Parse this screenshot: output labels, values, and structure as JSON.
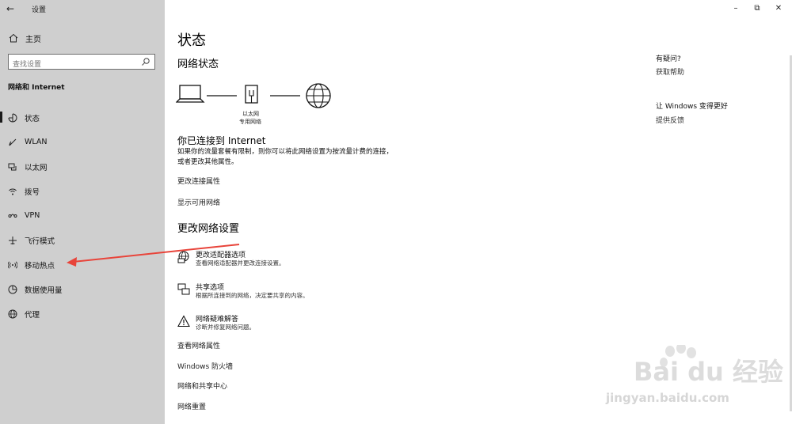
{
  "window": {
    "title": "设置"
  },
  "sidebar": {
    "home_label": "主页",
    "search_placeholder": "查找设置",
    "section_title": "网络和 Internet",
    "items": [
      {
        "label": "状态",
        "icon": "status-icon",
        "selected": true
      },
      {
        "label": "WLAN",
        "icon": "wifi-icon"
      },
      {
        "label": "以太网",
        "icon": "ethernet-icon"
      },
      {
        "label": "拨号",
        "icon": "dialup-icon"
      },
      {
        "label": "VPN",
        "icon": "vpn-icon"
      },
      {
        "label": "飞行模式",
        "icon": "airplane-icon"
      },
      {
        "label": "移动热点",
        "icon": "hotspot-icon"
      },
      {
        "label": "数据使用量",
        "icon": "data-usage-icon"
      },
      {
        "label": "代理",
        "icon": "globe-icon"
      }
    ]
  },
  "main": {
    "title": "状态",
    "network_status_heading": "网络状态",
    "diagram": {
      "label1": "以太网",
      "label2": "专用网络"
    },
    "connected_heading": "你已连接到 Internet",
    "connected_desc": "如果你的流量套餐有限制，则你可以将此网络设置为按流量计费的连接，或者更改其他属性。",
    "links_top": [
      "更改连接属性",
      "显示可用网络"
    ],
    "change_heading": "更改网络设置",
    "options": [
      {
        "title": "更改适配器选项",
        "desc": "查看网络适配器并更改连接设置。",
        "icon": "adapter-icon"
      },
      {
        "title": "共享选项",
        "desc": "根据所连接到的网络，决定要共享的内容。",
        "icon": "sharing-icon"
      },
      {
        "title": "网络疑难解答",
        "desc": "诊断并修复网络问题。",
        "icon": "warning-icon"
      }
    ],
    "links_bottom": [
      "查看网络属性",
      "Windows 防火墙",
      "网络和共享中心",
      "网络重置"
    ]
  },
  "right": {
    "question": "有疑问?",
    "help_link": "获取帮助",
    "improve_heading": "让 Windows 变得更好",
    "feedback_link": "提供反馈"
  },
  "watermark": {
    "text": "Bai du 经验",
    "url": "jingyan.baidu.com"
  },
  "colors": {
    "sidebar_bg": "#cfcfcf",
    "annotation_arrow": "#e8443a"
  }
}
